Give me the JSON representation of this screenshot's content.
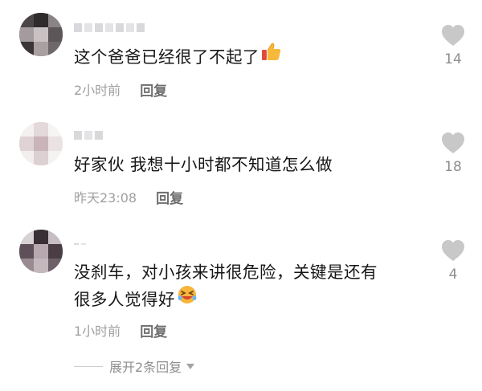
{
  "comments": [
    {
      "username": "",
      "text": "这个爸爸已经很了不起了",
      "emoji": "thumbs-up",
      "time": "2小时前",
      "reply_label": "回复",
      "likes": "14"
    },
    {
      "username": "",
      "text": "好家伙 我想十小时都不知道怎么做",
      "time": "昨天23:08",
      "reply_label": "回复",
      "likes": "18"
    },
    {
      "username": "",
      "text_line1": "没刹车，对小孩来讲很危险，关键是还有",
      "text_line2": "很多人觉得好",
      "emoji": "laughing-face",
      "time": "1小时前",
      "reply_label": "回复",
      "likes": "4"
    }
  ],
  "expand_replies": "展开2条回复",
  "colors": {
    "text": "#161616",
    "meta": "#a0a0a0",
    "reply": "#6e6e6e",
    "heart": "#c8c8c8"
  }
}
